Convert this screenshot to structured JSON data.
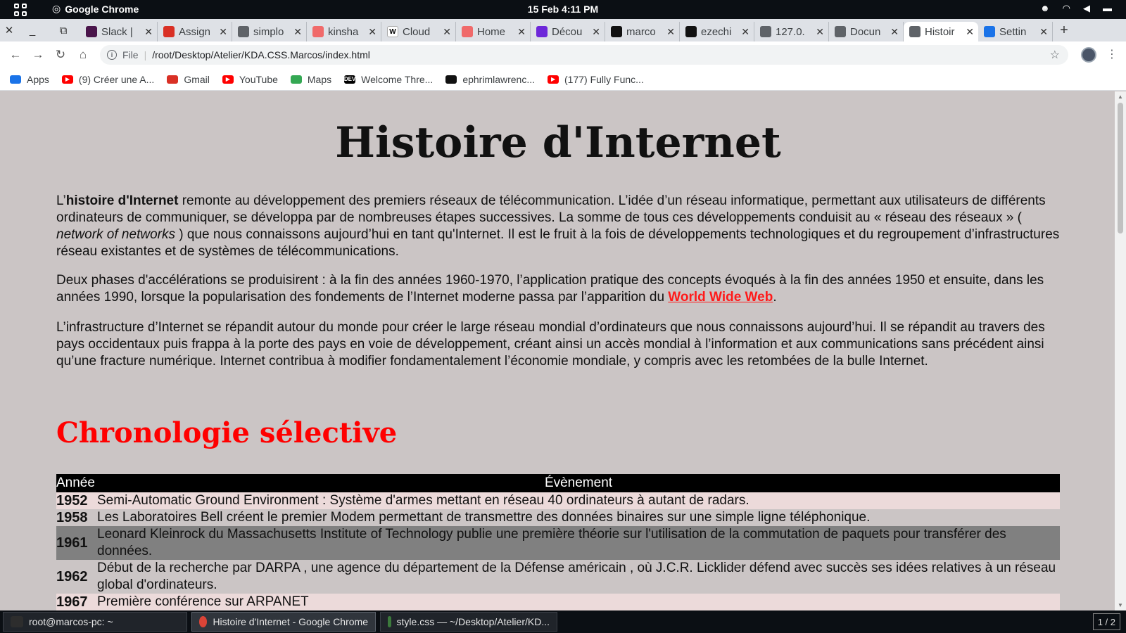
{
  "topbar": {
    "app_name": "Google Chrome",
    "clock": "15 Feb  4:11 PM"
  },
  "tabs": [
    {
      "label": "Slack |",
      "icon": "slack-icon",
      "color": "#4a154b"
    },
    {
      "label": "Assign",
      "icon": "gmail-icon",
      "color": "#d93025"
    },
    {
      "label": "simplo",
      "icon": "globe-icon",
      "color": "#5f6368"
    },
    {
      "label": "kinsha",
      "icon": "asana-icon",
      "color": "#f06a6a"
    },
    {
      "label": "Cloud",
      "icon": "wikipedia-icon",
      "color": "#ffffff"
    },
    {
      "label": "Home",
      "icon": "asana-icon",
      "color": "#f06a6a"
    },
    {
      "label": "Décou",
      "icon": "app-icon",
      "color": "#6d28d9"
    },
    {
      "label": "marco",
      "icon": "github-icon",
      "color": "#111111"
    },
    {
      "label": "ezechi",
      "icon": "github-icon",
      "color": "#111111"
    },
    {
      "label": "127.0.",
      "icon": "page-icon",
      "color": "#5f6368"
    },
    {
      "label": "Docun",
      "icon": "globe-icon",
      "color": "#5f6368"
    },
    {
      "label": "Histoir",
      "icon": "globe-icon",
      "color": "#5f6368",
      "active": true
    },
    {
      "label": "Settin",
      "icon": "gear-icon",
      "color": "#1a73e8"
    }
  ],
  "address": {
    "scheme": "File",
    "url": "/root/Desktop/Atelier/KDA.CSS.Marcos/index.html"
  },
  "bookmarks": [
    {
      "label": "Apps",
      "icon": "apps-grid-icon",
      "color": "#1a73e8"
    },
    {
      "label": "(9) Créer une A...",
      "icon": "youtube-icon",
      "color": "#ff0000"
    },
    {
      "label": "Gmail",
      "icon": "gmail-icon",
      "color": "#d93025"
    },
    {
      "label": "YouTube",
      "icon": "youtube-icon",
      "color": "#ff0000"
    },
    {
      "label": "Maps",
      "icon": "maps-icon",
      "color": "#34a853"
    },
    {
      "label": "Welcome Thre...",
      "icon": "dev-icon",
      "color": "#000000"
    },
    {
      "label": "ephrimlawrenc...",
      "icon": "github-icon",
      "color": "#111111"
    },
    {
      "label": "(177) Fully Func...",
      "icon": "youtube-icon",
      "color": "#ff0000"
    }
  ],
  "page": {
    "title": "Histoire d'Internet",
    "p1": {
      "lead": "L’",
      "bold": "histoire d'Internet",
      "text1": " remonte au développement des premiers réseaux de télécommunication. L’idée d’un réseau informatique, permettant aux utilisateurs de différents ordinateurs de communiquer, se développa par de nombreuses étapes successives. La somme de tous ces développements conduisit au « réseau des réseaux » ( ",
      "italic": "network of networks",
      "text2": "  ) que nous connaissons aujourd’hui en tant qu'Internet. Il est le fruit à la fois de développements technologiques et du regroupement d’infrastructures réseau existantes et de systèmes de télécommunications."
    },
    "p2": {
      "text": "Deux phases d'accélérations se produisirent : à la fin des années 1960-1970, l’application pratique des concepts évoqués à la fin des années 1950 et ensuite, dans les années 1990, lorsque la popularisation des fondements de l’Internet moderne passa par l’apparition du ",
      "link": "World Wide Web",
      "end": "."
    },
    "p3": "L’infrastructure d’Internet se répandit autour du monde pour créer le large réseau mondial d’ordinateurs que nous connaissons aujourd’hui. Il se répandit au travers des pays occidentaux puis frappa à la porte des pays en voie de développement, créant ainsi un accès mondial à l’information et aux communications sans précédent ainsi qu’une fracture numérique. Internet contribua à modifier fondamentalement l’économie mondiale, y compris avec les retombées de la bulle Internet.",
    "subtitle": "Chronologie sélective",
    "table": {
      "col_year": "Année",
      "col_event": "Évènement",
      "rows": [
        {
          "year": "1952",
          "event": "Semi-Automatic Ground Environment : Système d'armes mettant en réseau 40 ordinateurs à autant de radars."
        },
        {
          "year": "1958",
          "event": "Les Laboratoires Bell créent le premier Modem permettant de transmettre des données binaires sur une simple ligne téléphonique."
        },
        {
          "year": "1961",
          "event": "Leonard Kleinrock du Massachusetts Institute of Technology publie une première théorie sur l'utilisation de la commutation de paquets pour transférer des données."
        },
        {
          "year": "1962",
          "event": "Début de la recherche par DARPA , une agence du département de la Défense américain , où J.C.R. Licklider défend avec succès ses idées relatives à un réseau global d'ordinateurs."
        },
        {
          "year": "1967",
          "event": "Première conférence sur ARPANET"
        }
      ]
    }
  },
  "taskbar": {
    "items": [
      {
        "label": "root@marcos-pc: ~",
        "icon": "terminal-icon",
        "color": "#2d2d2d"
      },
      {
        "label": "Histoire d'Internet - Google Chrome",
        "icon": "chrome-icon",
        "color": "#db4437",
        "active": true
      },
      {
        "label": "style.css — ~/Desktop/Atelier/KD...",
        "icon": "editor-icon",
        "color": "#3c7a3c"
      }
    ],
    "pager": "1 / 2"
  },
  "colors": {
    "page_bg": "#cbc5c5",
    "heading_red": "#ff0000",
    "row_pink": "#ecdada",
    "row_gray": "#808080"
  }
}
